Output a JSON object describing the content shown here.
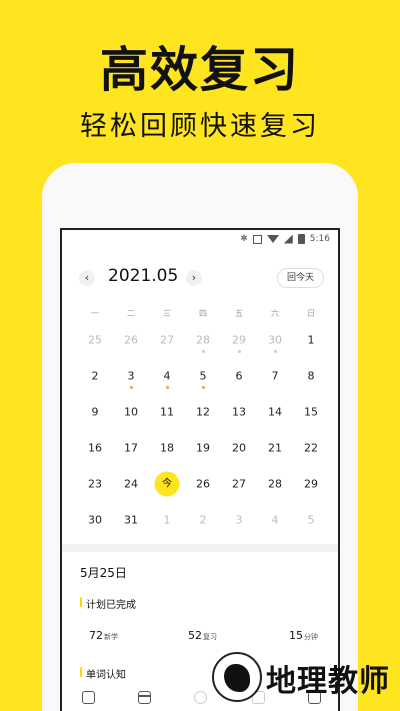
{
  "promo": {
    "headline": "高效复习",
    "subline": "轻松回顾快速复习"
  },
  "status_bar": {
    "time": "5:16"
  },
  "calendar": {
    "month_title": "2021.05",
    "prev_symbol": "‹",
    "next_symbol": "›",
    "today_button": "回今天",
    "weekdays": [
      "一",
      "二",
      "三",
      "四",
      "五",
      "六",
      "日"
    ],
    "rows": [
      [
        {
          "t": "25",
          "dim": true
        },
        {
          "t": "26",
          "dim": true
        },
        {
          "t": "27",
          "dim": true
        },
        {
          "t": "28",
          "dim": true,
          "dot": true
        },
        {
          "t": "29",
          "dim": true,
          "dot": true
        },
        {
          "t": "30",
          "dim": true,
          "dot": true
        },
        {
          "t": "1"
        }
      ],
      [
        {
          "t": "2"
        },
        {
          "t": "3",
          "dot": true
        },
        {
          "t": "4",
          "dot": true
        },
        {
          "t": "5",
          "dot": true
        },
        {
          "t": "6"
        },
        {
          "t": "7"
        },
        {
          "t": "8"
        }
      ],
      [
        {
          "t": "9"
        },
        {
          "t": "10"
        },
        {
          "t": "11"
        },
        {
          "t": "12"
        },
        {
          "t": "13"
        },
        {
          "t": "14"
        },
        {
          "t": "15"
        }
      ],
      [
        {
          "t": "16"
        },
        {
          "t": "17"
        },
        {
          "t": "18"
        },
        {
          "t": "19"
        },
        {
          "t": "20"
        },
        {
          "t": "21"
        },
        {
          "t": "22"
        }
      ],
      [
        {
          "t": "23"
        },
        {
          "t": "24"
        },
        {
          "t": "今",
          "today": true
        },
        {
          "t": "26"
        },
        {
          "t": "27"
        },
        {
          "t": "28"
        },
        {
          "t": "29"
        }
      ],
      [
        {
          "t": "30"
        },
        {
          "t": "31"
        },
        {
          "t": "1",
          "dim": true
        },
        {
          "t": "2",
          "dim": true
        },
        {
          "t": "3",
          "dim": true
        },
        {
          "t": "4",
          "dim": true
        },
        {
          "t": "5",
          "dim": true
        }
      ]
    ]
  },
  "detail": {
    "date": "5月25日",
    "plan_title": "计划已完成",
    "stats": {
      "new_value": "72",
      "new_unit": "新学",
      "review_value": "52",
      "review_unit": "复习",
      "minutes_value": "15",
      "minutes_unit": "分钟"
    },
    "vocab_title": "单词认知"
  },
  "watermark": {
    "text": "地理教师"
  },
  "colors": {
    "brand_yellow": "#FFE51F",
    "dot_orange": "#F5A623"
  }
}
